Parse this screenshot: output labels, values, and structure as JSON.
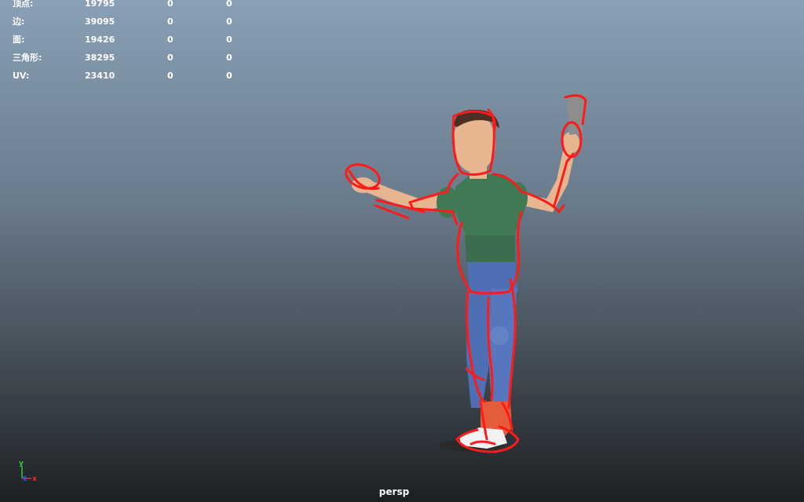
{
  "hud": {
    "rows": [
      {
        "label": "顶点:",
        "total": "19795",
        "selected": "0",
        "tri": "0"
      },
      {
        "label": "边:",
        "total": "39095",
        "selected": "0",
        "tri": "0"
      },
      {
        "label": "面:",
        "total": "19426",
        "selected": "0",
        "tri": "0"
      },
      {
        "label": "三角形:",
        "total": "38295",
        "selected": "0",
        "tri": "0"
      },
      {
        "label": "UV:",
        "total": "23410",
        "selected": "0",
        "tri": "0"
      }
    ]
  },
  "axis": {
    "y": "y",
    "x": "x",
    "z": "z"
  },
  "camera": {
    "name": "persp"
  },
  "colors": {
    "shirt": "#3f7a55",
    "jeans": "#4f6fb5",
    "skin": "#e7b58f",
    "hair": "#4a2f22",
    "shoe": "#e45c3a",
    "outline": "#ff1a1a"
  }
}
